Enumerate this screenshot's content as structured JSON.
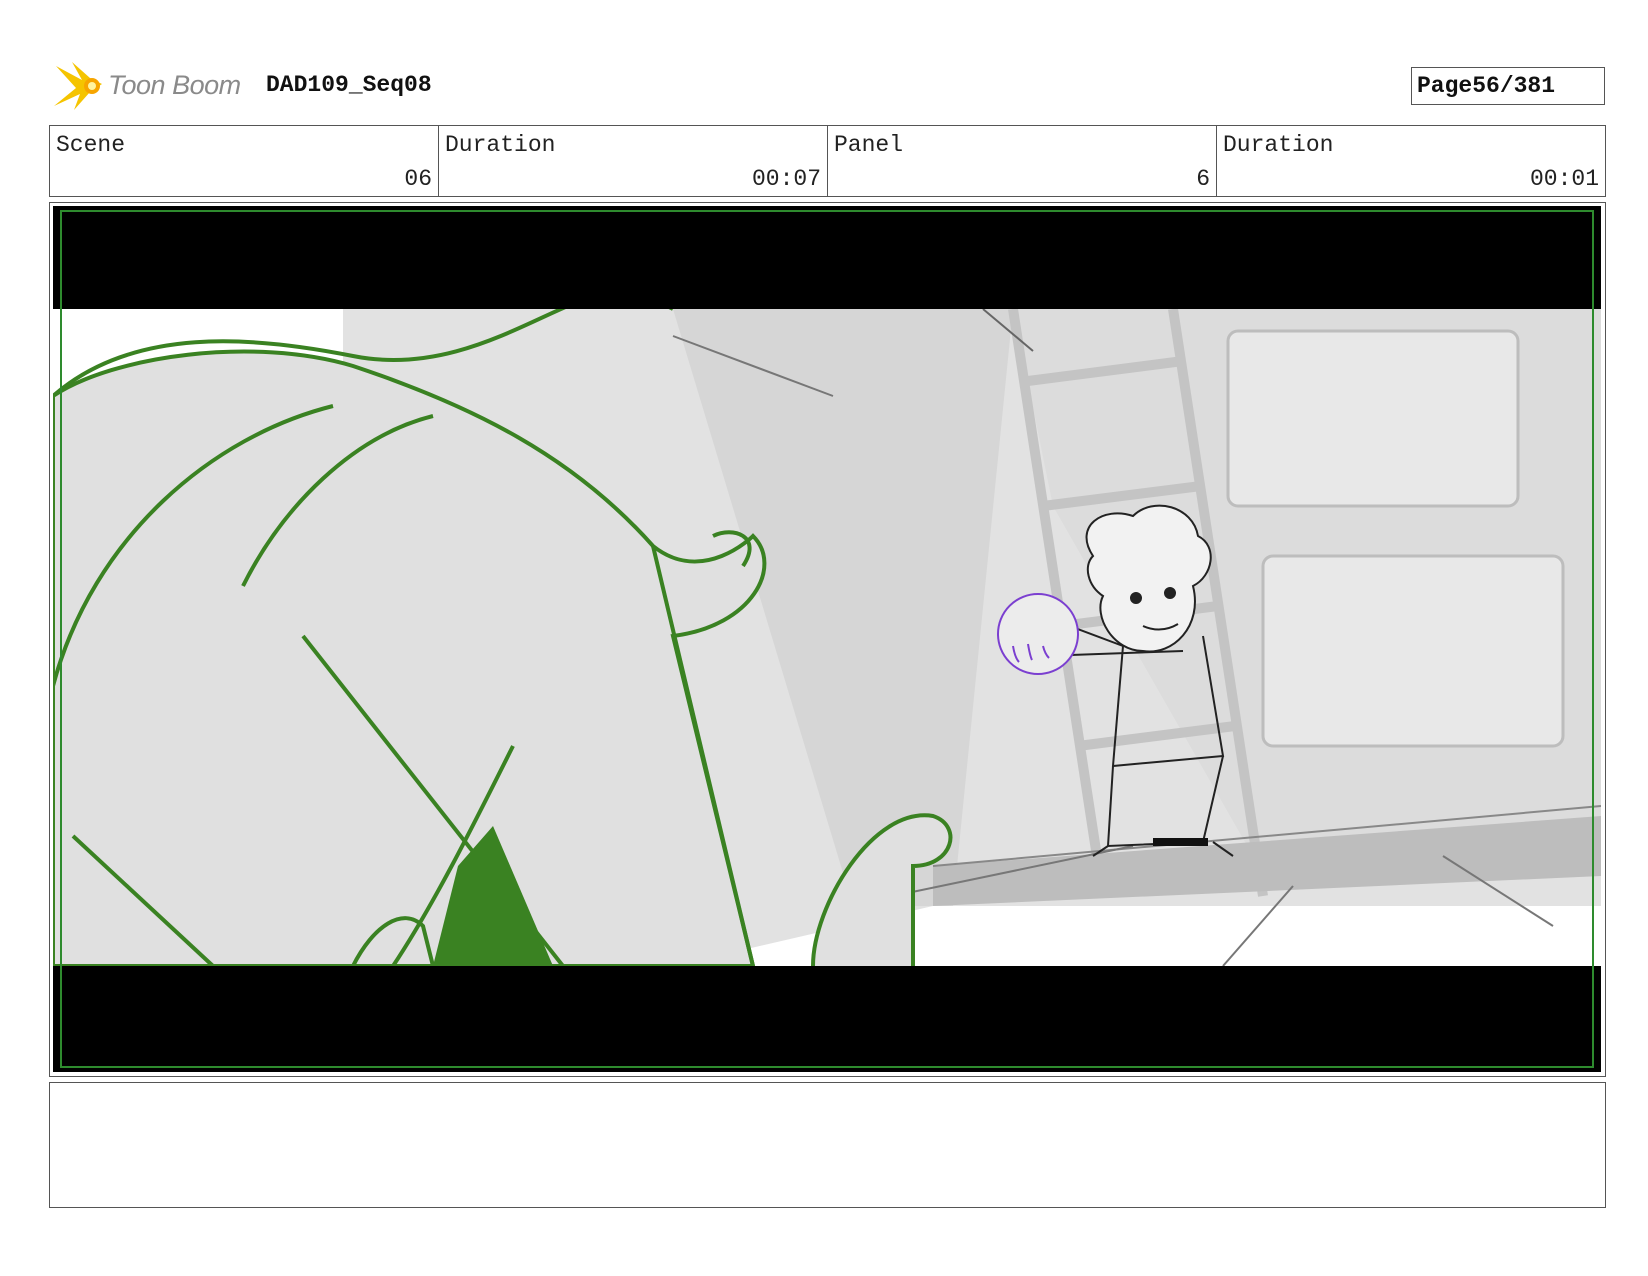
{
  "header": {
    "logo_text": "Toon Boom",
    "project_title": "DAD109_Seq08",
    "page_label": "Page",
    "page_number": "56/381"
  },
  "info": [
    {
      "label": "Scene",
      "value": "06"
    },
    {
      "label": "Duration",
      "value": "00:07"
    },
    {
      "label": "Panel",
      "value": "6"
    },
    {
      "label": "Duration",
      "value": "00:01"
    }
  ],
  "notes": {
    "text": ""
  },
  "colors": {
    "letterbox": "#000000",
    "safe_frame": "#2e8b2e",
    "foreground_character": "#3a8222",
    "highlight_sketch": "#7b3fd0",
    "logo_star": "#f5c400"
  },
  "icons": {
    "logo": "toon-boom-star-icon"
  }
}
